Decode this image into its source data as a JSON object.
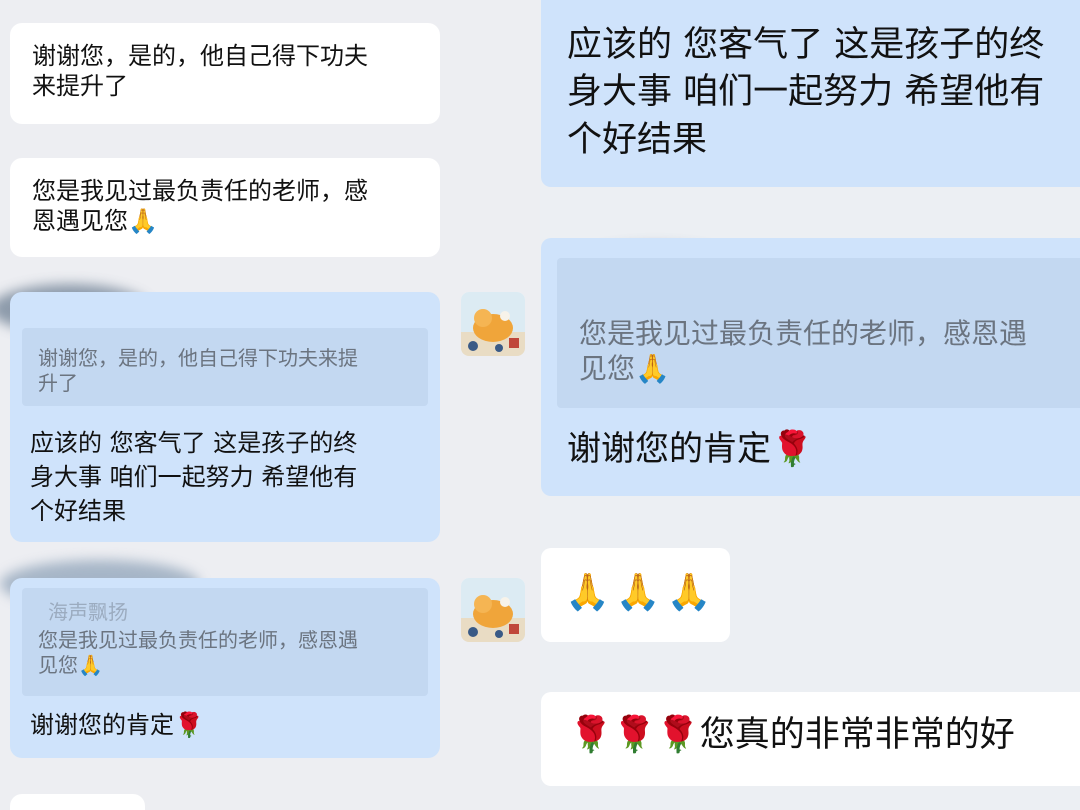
{
  "left": {
    "msg1": "谢谢您，是的，他自己得下功夫\n来提升了",
    "msg2": "您是我见过最负责任的老师，感\n恩遇见您🙏",
    "reply1": {
      "quote": "谢谢您，是的，他自己得下功夫来提\n升了",
      "text": "应该的 您客气了 这是孩子的终\n身大事 咱们一起努力 希望他有\n个好结果"
    },
    "reply2": {
      "quote_name": "海声飘扬",
      "quote": "您是我见过最负责任的老师，感恩遇\n见您🙏",
      "text": "谢谢您的肯定🌹"
    }
  },
  "right": {
    "msg1": "应该的 您客气了 这是孩子的终\n身大事 咱们一起努力 希望他有\n个好结果",
    "reply1": {
      "quote": "您是我见过最负责任的老师，感恩遇\n见您🙏",
      "text": "谢谢您的肯定🌹"
    },
    "msg2": "🙏🙏🙏",
    "msg3": "🌹🌹🌹您真的非常非常的好"
  },
  "colors": {
    "bubble_blue": "#cfe3fb",
    "bubble_white": "#ffffff",
    "quote_bg": "#c3d8f1",
    "chat_bg": "#edeef2"
  }
}
